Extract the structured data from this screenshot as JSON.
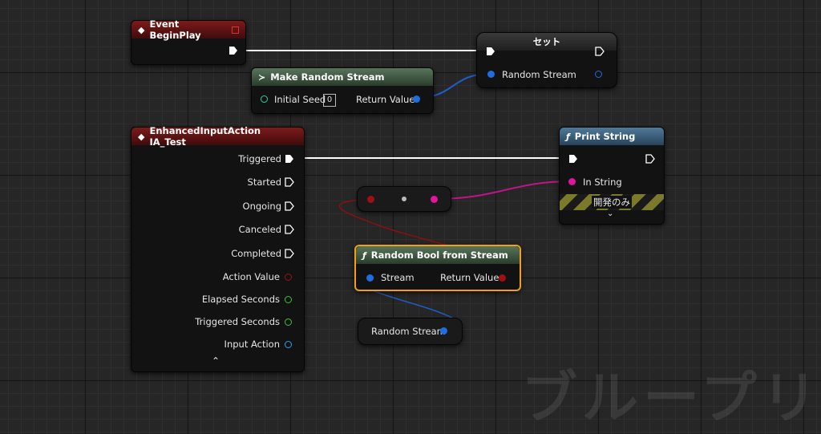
{
  "nodes": {
    "begin_play": {
      "title": "Event BeginPlay"
    },
    "make_random_stream": {
      "title": "Make Random Stream",
      "initial_seed_label": "Initial Seed",
      "initial_seed_value": "0",
      "return_value_label": "Return Value"
    },
    "set": {
      "title": "セット",
      "random_stream_label": "Random Stream"
    },
    "enhanced_input": {
      "title": "EnhancedInputAction IA_Test",
      "pins": [
        "Triggered",
        "Started",
        "Ongoing",
        "Canceled",
        "Completed",
        "Action Value",
        "Elapsed Seconds",
        "Triggered Seconds",
        "Input Action"
      ]
    },
    "print_string": {
      "title": "Print String",
      "in_string_label": "In String",
      "dev_only_label": "開発のみ"
    },
    "random_bool": {
      "title": "Random Bool from Stream",
      "stream_label": "Stream",
      "return_value_label": "Return Value"
    },
    "random_stream_var": {
      "label": "Random Stream"
    }
  },
  "watermark": "ブループリント",
  "colors": {
    "exec": "#ffffff",
    "struct_pin": "#1e6ee0",
    "string_pin": "#e0159c",
    "bool_pin": "#a01010",
    "float_pin": "#3cc43c",
    "int_pin": "#2ad0a0",
    "object_pin": "#27a5e6",
    "event_header": "#7d1a1a",
    "pure_header": "#57745a",
    "function_header": "#4f7a9a",
    "selection": "#f0a010"
  }
}
